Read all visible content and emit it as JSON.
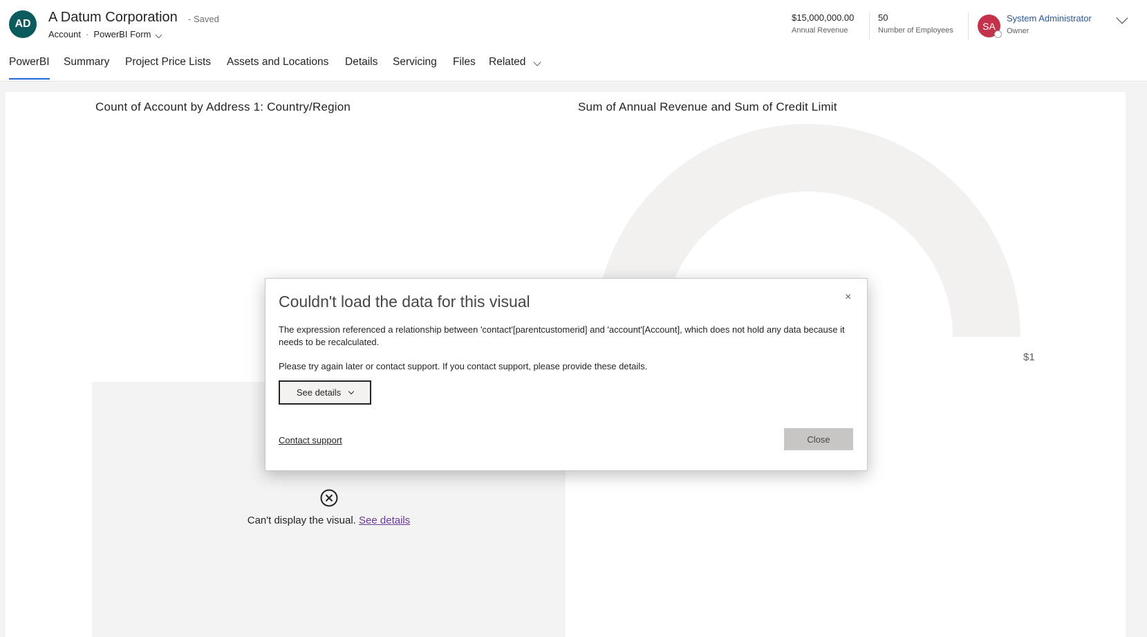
{
  "record": {
    "initials": "AD",
    "title": "A Datum Corporation",
    "saved_status": "- Saved",
    "entity": "Account",
    "separator": "·",
    "form_name": "PowerBI Form"
  },
  "kpis": [
    {
      "value": "$15,000,000.00",
      "label": "Annual Revenue"
    },
    {
      "value": "50",
      "label": "Number of Employees"
    }
  ],
  "owner": {
    "initials": "SA",
    "name": "System Administrator",
    "label": "Owner"
  },
  "tabs": [
    {
      "label": "PowerBI",
      "active": true
    },
    {
      "label": "Summary"
    },
    {
      "label": "Project Price Lists"
    },
    {
      "label": "Assets and Locations"
    },
    {
      "label": "Details"
    },
    {
      "label": "Servicing"
    },
    {
      "label": "Files"
    },
    {
      "label": "Related"
    }
  ],
  "report": {
    "visual1_title": "Count of Account by Address 1: Country/Region",
    "visual2_title": "Sum of Annual Revenue and Sum of Credit Limit",
    "gauge_max_label": "$1",
    "error_visual_text": "Can't display the visual.",
    "error_visual_link": "See details"
  },
  "modal": {
    "title": "Couldn't load the data for this visual",
    "close_icon": "×",
    "message": "The expression referenced a relationship between 'contact'[parentcustomerid] and 'account'[Account], which does not hold any data because it needs to be recalculated.",
    "message2": "Please try again later or contact support. If you contact support, please provide these details.",
    "see_details_label": "See details",
    "contact_support_label": "Contact support",
    "close_label": "Close"
  },
  "colors": {
    "record_avatar": "#0b5a5e",
    "owner_avatar": "#c4314b",
    "active_tab_underline": "#2266e3",
    "owner_link": "#2b5797",
    "gauge_track": "#f2f1f0"
  }
}
